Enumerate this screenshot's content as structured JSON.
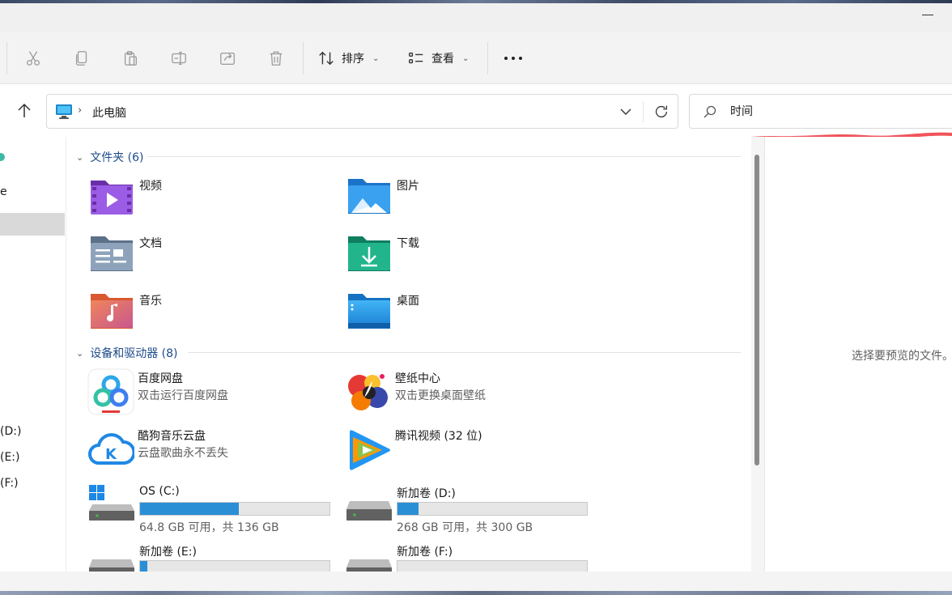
{
  "toolbar": {
    "sort_label": "排序",
    "view_label": "查看"
  },
  "address": {
    "crumb": "此电脑"
  },
  "search": {
    "value": "时间"
  },
  "nav": {
    "fragments": [
      "e",
      "(D:)",
      "(E:)",
      "(F:)"
    ]
  },
  "folders_group": {
    "title": "文件夹 (6)",
    "items": [
      {
        "name": "视频",
        "icon": "videos-folder-icon"
      },
      {
        "name": "图片",
        "icon": "pictures-folder-icon"
      },
      {
        "name": "文档",
        "icon": "documents-folder-icon"
      },
      {
        "name": "下载",
        "icon": "downloads-folder-icon"
      },
      {
        "name": "音乐",
        "icon": "music-folder-icon"
      },
      {
        "name": "桌面",
        "icon": "desktop-folder-icon"
      }
    ]
  },
  "devices_group": {
    "title": "设备和驱动器 (8)",
    "apps": [
      {
        "name": "百度网盘",
        "desc": "双击运行百度网盘",
        "icon": "baidu-netdisk-icon"
      },
      {
        "name": "壁纸中心",
        "desc": "双击更换桌面壁纸",
        "icon": "wallpaper-center-icon"
      },
      {
        "name": "酷狗音乐云盘",
        "desc": "云盘歌曲永不丢失",
        "icon": "kugou-music-icon"
      },
      {
        "name": "腾讯视频 (32 位)",
        "desc": "",
        "icon": "tencent-video-icon"
      }
    ],
    "drives": [
      {
        "name": "OS (C:)",
        "free": "64.8 GB 可用，共 136 GB",
        "used_fraction": 0.52
      },
      {
        "name": "新加卷 (D:)",
        "free": "268 GB 可用，共 300 GB",
        "used_fraction": 0.11
      },
      {
        "name": "新加卷 (E:)",
        "free": "",
        "used_fraction": 0.04
      },
      {
        "name": "新加卷 (F:)",
        "free": "",
        "used_fraction": 0.0
      }
    ]
  },
  "preview": {
    "placeholder": "选择要预览的文件。"
  },
  "colors": {
    "accent": "#2b8fd6",
    "group_header": "#1d4b8a",
    "annotation_red": "#f0555a"
  }
}
